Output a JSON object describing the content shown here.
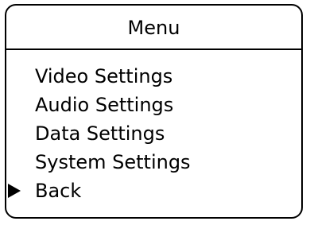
{
  "menu": {
    "title": "Menu",
    "items": [
      {
        "label": "Video Settings",
        "selected": false
      },
      {
        "label": "Audio Settings",
        "selected": false
      },
      {
        "label": "Data Settings",
        "selected": false
      },
      {
        "label": "System Settings",
        "selected": false
      },
      {
        "label": "Back",
        "selected": true
      }
    ],
    "selector_icon": "triangle-right-icon"
  }
}
